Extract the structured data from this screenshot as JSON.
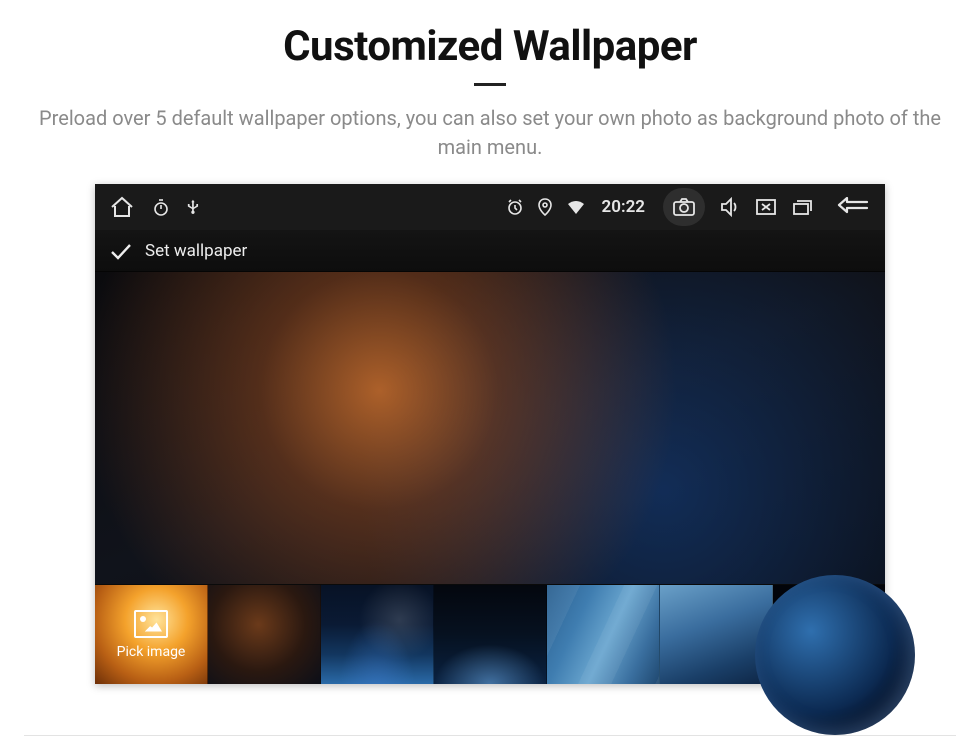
{
  "page": {
    "title": "Customized Wallpaper",
    "subtitle": "Preload over 5 default wallpaper options, you can also set your own photo as background photo of the main menu."
  },
  "statusbar": {
    "time": "20:22"
  },
  "action": {
    "set_wallpaper_label": "Set wallpaper"
  },
  "thumbs": {
    "pick_label": "Pick image"
  }
}
